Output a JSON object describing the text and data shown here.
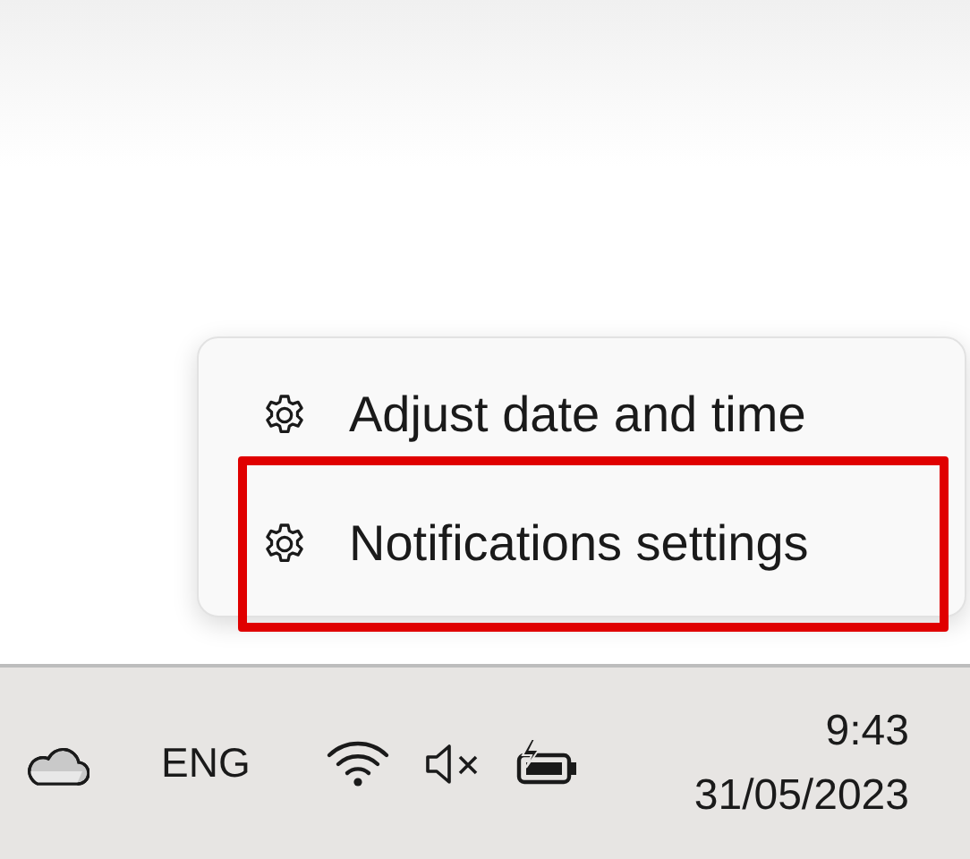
{
  "context_menu": {
    "items": [
      {
        "label": "Adjust date and time",
        "highlighted": false
      },
      {
        "label": "Notifications settings",
        "highlighted": true
      }
    ]
  },
  "taskbar": {
    "language": "ENG",
    "volume": {
      "muted": true
    },
    "battery": {
      "charging": true
    },
    "clock": {
      "time": "9:43",
      "date": "31/05/2023"
    }
  }
}
